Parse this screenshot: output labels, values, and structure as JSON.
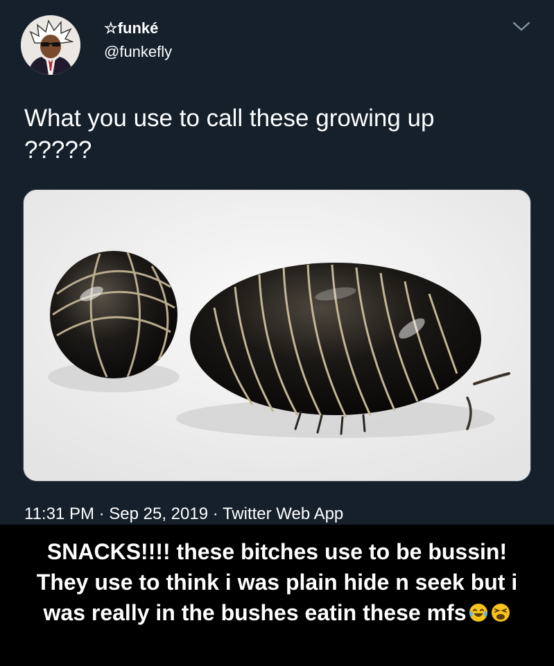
{
  "tweet": {
    "author": {
      "display_name": "☆funké",
      "handle": "@funkefly",
      "avatar_icon": "avatar-illustration-icon"
    },
    "menu_icon": "chevron-down-icon",
    "text_lines": [
      "What you use to call these growing up",
      "?????"
    ],
    "media": {
      "icon": "photo-pill-bugs",
      "background": "#f2f2f2"
    },
    "meta": "11:31 PM · Sep 25, 2019 · Twitter Web App"
  },
  "caption": {
    "line1": "SNACKS!!!! these bitches use to be bussin!",
    "line2": "They use to think i was plain hide n seek but i",
    "line3": "was really in the bushes eatin these mfs",
    "emojis": [
      "tears-of-joy-emoji",
      "weary-face-emoji"
    ]
  },
  "colors": {
    "tweet_background": "#15202b",
    "page_background": "#000000",
    "text": "#ffffff"
  }
}
